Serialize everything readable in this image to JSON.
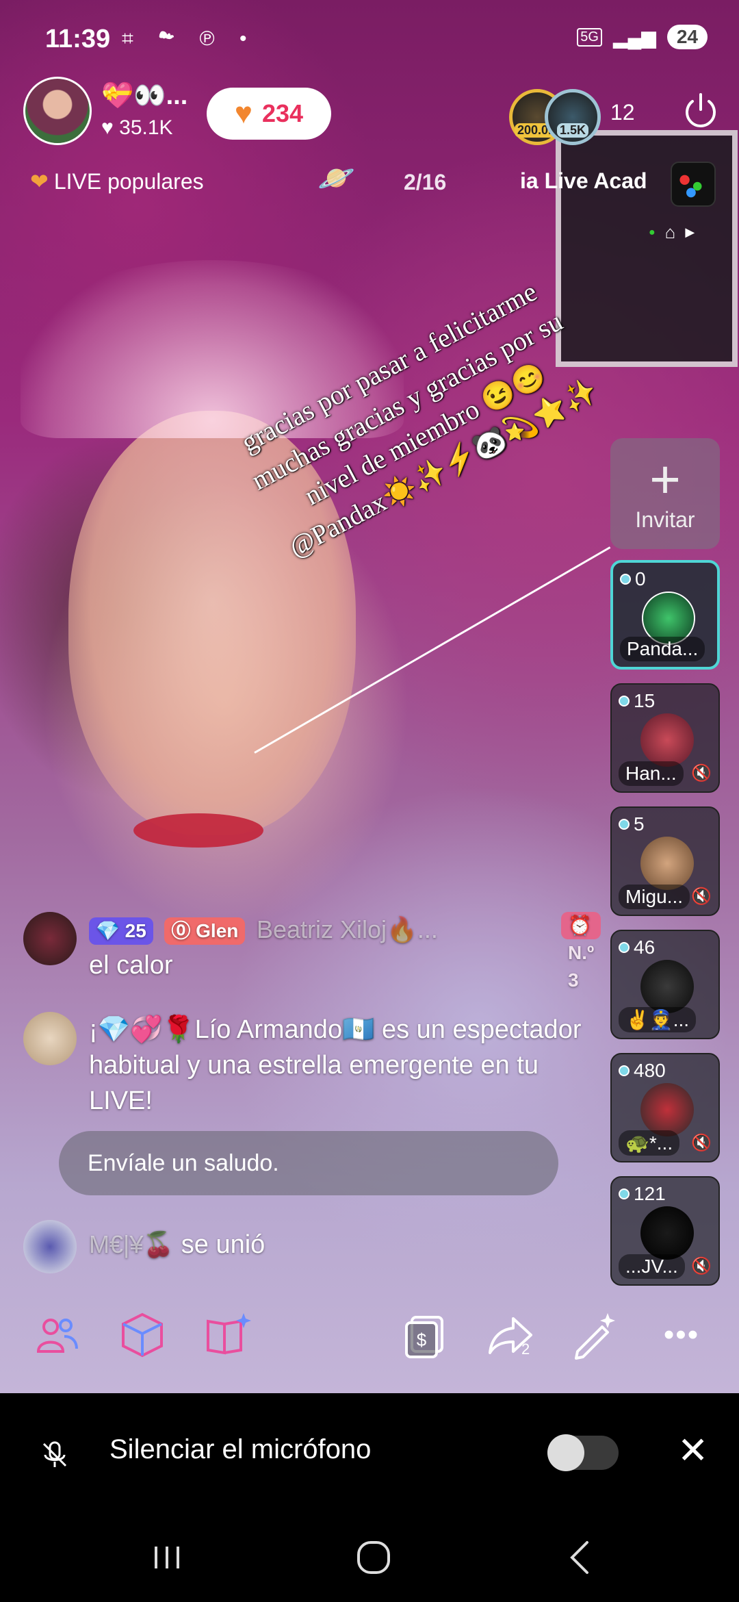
{
  "status_bar": {
    "time": "11:39",
    "icons": "⌗ ☁ ℗ •",
    "network": "5G",
    "battery": "24"
  },
  "header": {
    "host_name": "💝👀...",
    "host_likes": "35.1K",
    "like_count": "234",
    "top_viewers": [
      {
        "badge": "200.0K"
      },
      {
        "badge": "1.5K"
      }
    ],
    "viewer_count": "12"
  },
  "subheader": {
    "popular_label": "LIVE populares",
    "rank": "2/16",
    "marquee": "ia Live   Acad"
  },
  "overlay": {
    "lines": [
      "gracias por pasar a felicitarme",
      "muchas gracias y gracias por su",
      "nivel de miembro 😉😊",
      "@Pandax☀️✨⚡🐼💫⭐✨"
    ]
  },
  "invite": {
    "label": "Invitar",
    "plus": "+"
  },
  "guests": [
    {
      "count": "0",
      "name": "Panda...",
      "active": true,
      "muted": false
    },
    {
      "count": "15",
      "name": "Han...",
      "active": false,
      "muted": true
    },
    {
      "count": "5",
      "name": "Migu...",
      "active": false,
      "muted": true
    },
    {
      "count": "46",
      "name": "✌️👮...",
      "active": false,
      "muted": false
    },
    {
      "count": "480",
      "name": "🐢*...",
      "active": false,
      "muted": true
    },
    {
      "count": "121",
      "name": "...JV...",
      "active": false,
      "muted": true
    }
  ],
  "chat": [
    {
      "level": "25",
      "fan": "Glen",
      "user": "Beatriz Xiloj🔥...",
      "rank": "N.º 3",
      "text": "el calor"
    },
    {
      "text": "¡💎💞🌹Lío Armando🇬🇹 es un espectador habitual y una estrella emergente en tu LIVE!"
    },
    {
      "user": "M€|¥🍒",
      "text": "se unió"
    }
  ],
  "greeting_button": "Envíale un saludo.",
  "tools": {
    "share_count": "2"
  },
  "mic_bar": {
    "label": "Silenciar el micrófono"
  },
  "colors": {
    "accent_pink": "#e9305d",
    "guest_active": "#4fd6d6",
    "level_badge": "#6b55e8"
  }
}
